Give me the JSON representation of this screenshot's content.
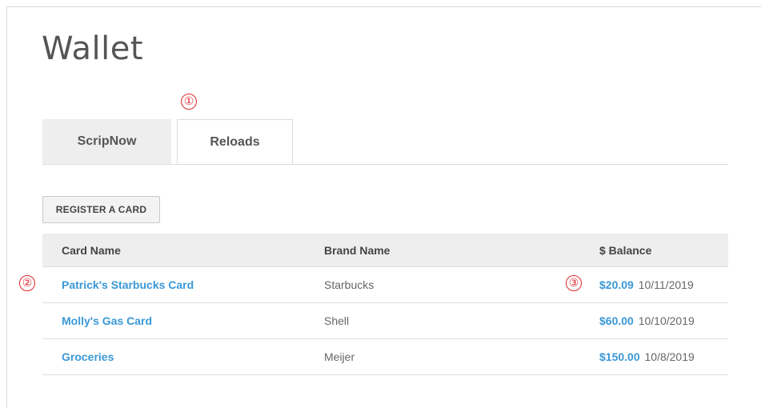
{
  "page": {
    "title": "Wallet"
  },
  "tabs": [
    {
      "label": "ScripNow",
      "active": false
    },
    {
      "label": "Reloads",
      "active": true
    }
  ],
  "markers": [
    "①",
    "②",
    "③"
  ],
  "register_button": "REGISTER A CARD",
  "table": {
    "headers": [
      "Card Name",
      "Brand Name",
      "$ Balance"
    ],
    "rows": [
      {
        "card": "Patrick's Starbucks Card",
        "brand": "Starbucks",
        "balance": "$20.09",
        "date": "10/11/2019"
      },
      {
        "card": "Molly's Gas Card",
        "brand": "Shell",
        "balance": "$60.00",
        "date": "10/10/2019"
      },
      {
        "card": "Groceries",
        "brand": "Meijer",
        "balance": "$150.00",
        "date": "10/8/2019"
      }
    ]
  },
  "colors": {
    "link": "#3a98d6",
    "marker": "#e0282c",
    "tab_inactive_bg": "#eeeeee"
  }
}
